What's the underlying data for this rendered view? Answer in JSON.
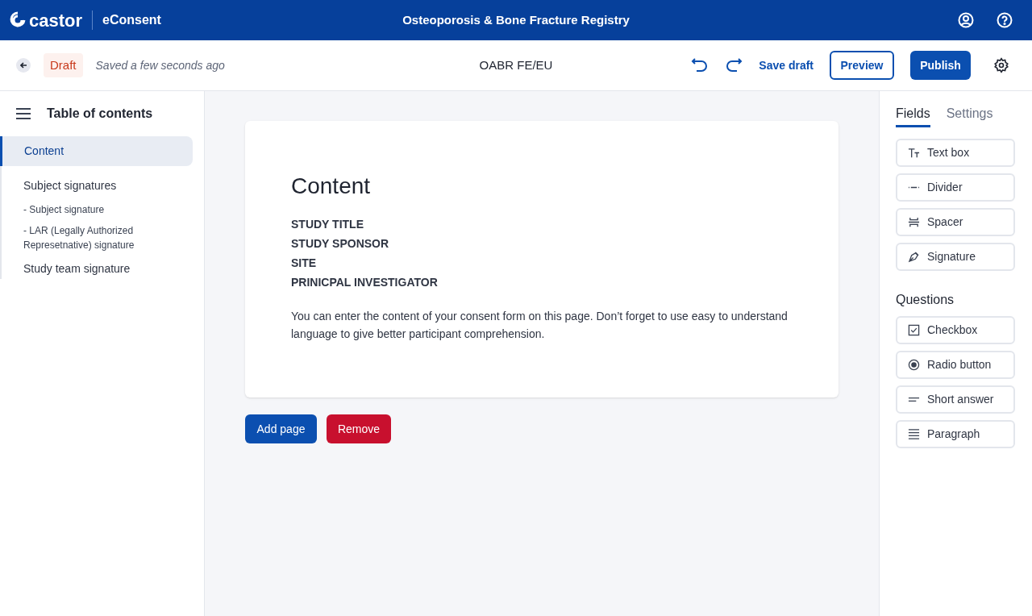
{
  "header": {
    "logo": "castor",
    "product": "eConsent",
    "title": "Osteoporosis & Bone Fracture Registry"
  },
  "toolbar": {
    "status": "Draft",
    "saved": "Saved a few seconds ago",
    "document": "OABR FE/EU",
    "save": "Save draft",
    "preview": "Preview",
    "publish": "Publish"
  },
  "toc": {
    "title": "Table of contents",
    "items": [
      {
        "label": "Content",
        "selected": true
      },
      {
        "label": "Subject signatures",
        "selected": false,
        "children": [
          {
            "label": "- Subject signature",
            "selected": false
          },
          {
            "label": "- LAR (Legally Authorized Represetnative) signature",
            "selected": false
          }
        ]
      },
      {
        "label": "Study team signature",
        "selected": false
      }
    ]
  },
  "page": {
    "title": "Content",
    "headings": [
      "STUDY TITLE",
      "STUDY SPONSOR",
      "SITE",
      "PRINICPAL INVESTIGATOR"
    ],
    "body": "You can enter the content of your consent form on this page. Don’t forget to use easy to understand language to give better participant comprehension."
  },
  "actions": {
    "add": "Add page",
    "remove": "Remove"
  },
  "panel": {
    "tabs": [
      {
        "label": "Fields",
        "selected": true
      },
      {
        "label": "Settings",
        "selected": false
      }
    ],
    "fields": [
      {
        "kind": "textbox",
        "label": "Text box"
      },
      {
        "kind": "divider",
        "label": "Divider"
      },
      {
        "kind": "spacer",
        "label": "Spacer"
      },
      {
        "kind": "signature",
        "label": "Signature"
      }
    ],
    "questions_title": "Questions",
    "questions": [
      {
        "kind": "checkbox",
        "label": "Checkbox"
      },
      {
        "kind": "radio",
        "label": "Radio button"
      },
      {
        "kind": "short",
        "label": "Short answer"
      },
      {
        "kind": "paragraph",
        "label": "Paragraph"
      }
    ]
  }
}
